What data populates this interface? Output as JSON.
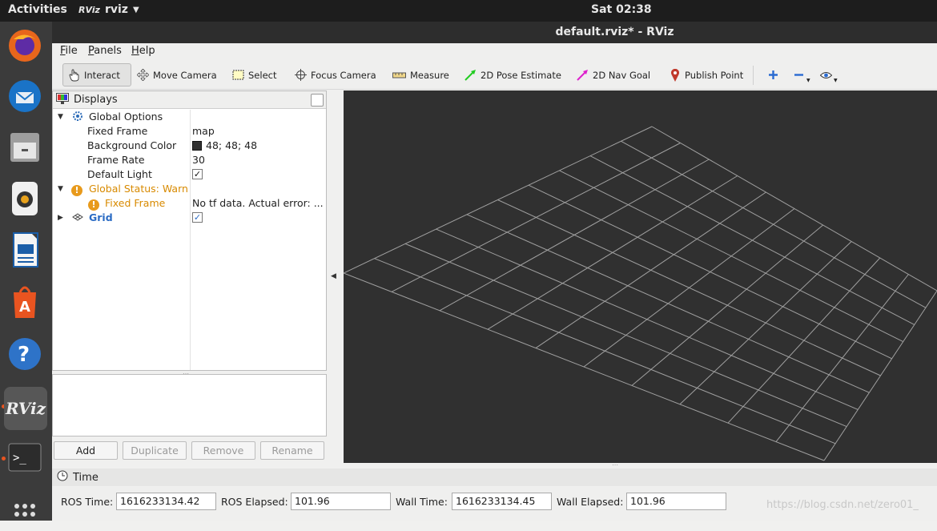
{
  "topbar": {
    "activities": "Activities",
    "app_name": "rviz",
    "app_logo": "RViz",
    "clock": "Sat 02:38"
  },
  "dock": [
    "firefox-icon",
    "thunderbird-icon",
    "files-icon",
    "rhythmbox-icon",
    "writer-icon",
    "software-icon",
    "help-icon",
    "rviz-icon",
    "terminal-icon",
    "app-grid-icon"
  ],
  "window": {
    "title": "default.rviz* - RViz"
  },
  "menu": {
    "file": "File",
    "panels": "Panels",
    "help": "Help"
  },
  "toolbar": {
    "interact": "Interact",
    "move_camera": "Move Camera",
    "select": "Select",
    "focus_camera": "Focus Camera",
    "measure": "Measure",
    "pose_estimate": "2D Pose Estimate",
    "nav_goal": "2D Nav Goal",
    "publish_point": "Publish Point",
    "pose_color": "#22cc22",
    "nav_color": "#dd22cc",
    "point_color": "#c0392b"
  },
  "displays": {
    "title": "Displays",
    "global_options": "Global Options",
    "fixed_frame_label": "Fixed Frame",
    "fixed_frame_value": "map",
    "bg_color_label": "Background Color",
    "bg_color_value": "48; 48; 48",
    "bg_swatch": "#303030",
    "frame_rate_label": "Frame Rate",
    "frame_rate_value": "30",
    "default_light_label": "Default Light",
    "default_light_checked": true,
    "status_label": "Global Status: Warn",
    "status_fixed_frame": "Fixed Frame",
    "status_error": "No tf data.  Actual error: ...",
    "grid_label": "Grid",
    "grid_checked": true
  },
  "buttons": {
    "add": "Add",
    "duplicate": "Duplicate",
    "remove": "Remove",
    "rename": "Rename"
  },
  "time": {
    "title": "Time",
    "ros_time_label": "ROS Time:",
    "ros_time": "1616233134.42",
    "ros_elapsed_label": "ROS Elapsed:",
    "ros_elapsed": "101.96",
    "wall_time_label": "Wall Time:",
    "wall_time": "1616233134.45",
    "wall_elapsed_label": "Wall Elapsed:",
    "wall_elapsed": "101.96"
  },
  "watermark": "https://blog.csdn.net/zero01_"
}
